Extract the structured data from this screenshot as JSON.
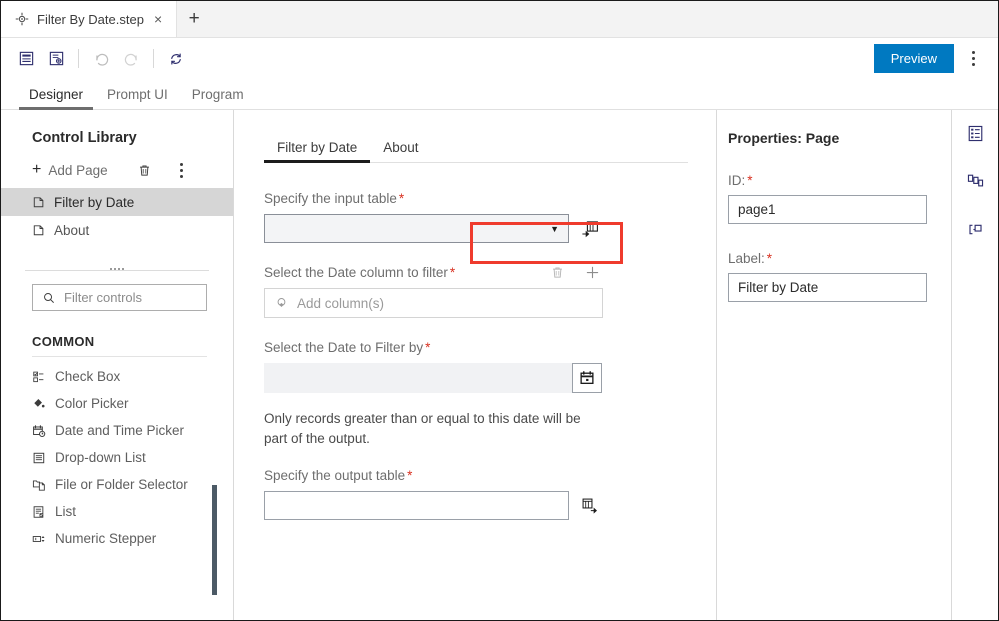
{
  "window": {
    "doc_tab_title": "Filter By Date.step",
    "doc_tab_close": "×",
    "new_tab": "+"
  },
  "toolbar": {
    "buttons": [
      {
        "name": "properties-panel-toggle",
        "icon": "panel-icon"
      },
      {
        "name": "page-settings",
        "icon": "page-settings-icon"
      },
      {
        "name": "undo",
        "icon": "undo-icon"
      },
      {
        "name": "redo",
        "icon": "redo-icon"
      },
      {
        "name": "refresh",
        "icon": "refresh-icon"
      }
    ],
    "preview_label": "Preview",
    "preview_color": "#0079c1",
    "overflow_label": "More options"
  },
  "section_tabs": [
    {
      "label": "Designer",
      "active": true
    },
    {
      "label": "Prompt UI",
      "active": false
    },
    {
      "label": "Program",
      "active": false
    }
  ],
  "sidebar": {
    "title": "Control Library",
    "add_page_label": "Add Page",
    "delete_tooltip": "Delete",
    "more_tooltip": "More",
    "pages": [
      {
        "label": "Filter by Date",
        "selected": true
      },
      {
        "label": "About",
        "selected": false
      }
    ],
    "search_placeholder": "Filter controls",
    "category": "COMMON",
    "controls": [
      {
        "label": "Check Box",
        "icon": "check-box-icon"
      },
      {
        "label": "Color Picker",
        "icon": "color-picker-icon"
      },
      {
        "label": "Date and Time Picker",
        "icon": "calendar-clock-icon"
      },
      {
        "label": "Drop-down List",
        "icon": "dropdown-list-icon"
      },
      {
        "label": "File or Folder Selector",
        "icon": "file-folder-icon"
      },
      {
        "label": "List",
        "icon": "list-icon"
      },
      {
        "label": "Numeric Stepper",
        "icon": "numeric-stepper-icon"
      }
    ]
  },
  "canvas": {
    "tabs": [
      {
        "label": "Filter by Date",
        "active": true,
        "highlighted": true
      },
      {
        "label": "About",
        "active": false,
        "highlighted": false
      }
    ],
    "highlight_color": "#ef3b2d",
    "fields": {
      "input_table_label": "Specify the input table",
      "input_table_value": "",
      "column_label": "Select the Date column to filter",
      "column_placeholder": "Add column(s)",
      "date_label": "Select the Date to Filter by ",
      "date_value": "",
      "helper_text": "Only records greater than or equal to this date will be part of the output.",
      "output_table_label": "Specify the output table",
      "output_table_value": "",
      "required_mark": "*"
    }
  },
  "properties": {
    "title": "Properties: Page",
    "id_label": "ID:",
    "id_value": "page1",
    "label_label": "Label:",
    "label_value": "Filter by Date",
    "required_mark": "*"
  },
  "rail": [
    {
      "name": "rail-properties",
      "icon": "properties-list-icon"
    },
    {
      "name": "rail-model",
      "icon": "model-blocks-icon"
    },
    {
      "name": "rail-binding",
      "icon": "binding-link-icon"
    }
  ]
}
